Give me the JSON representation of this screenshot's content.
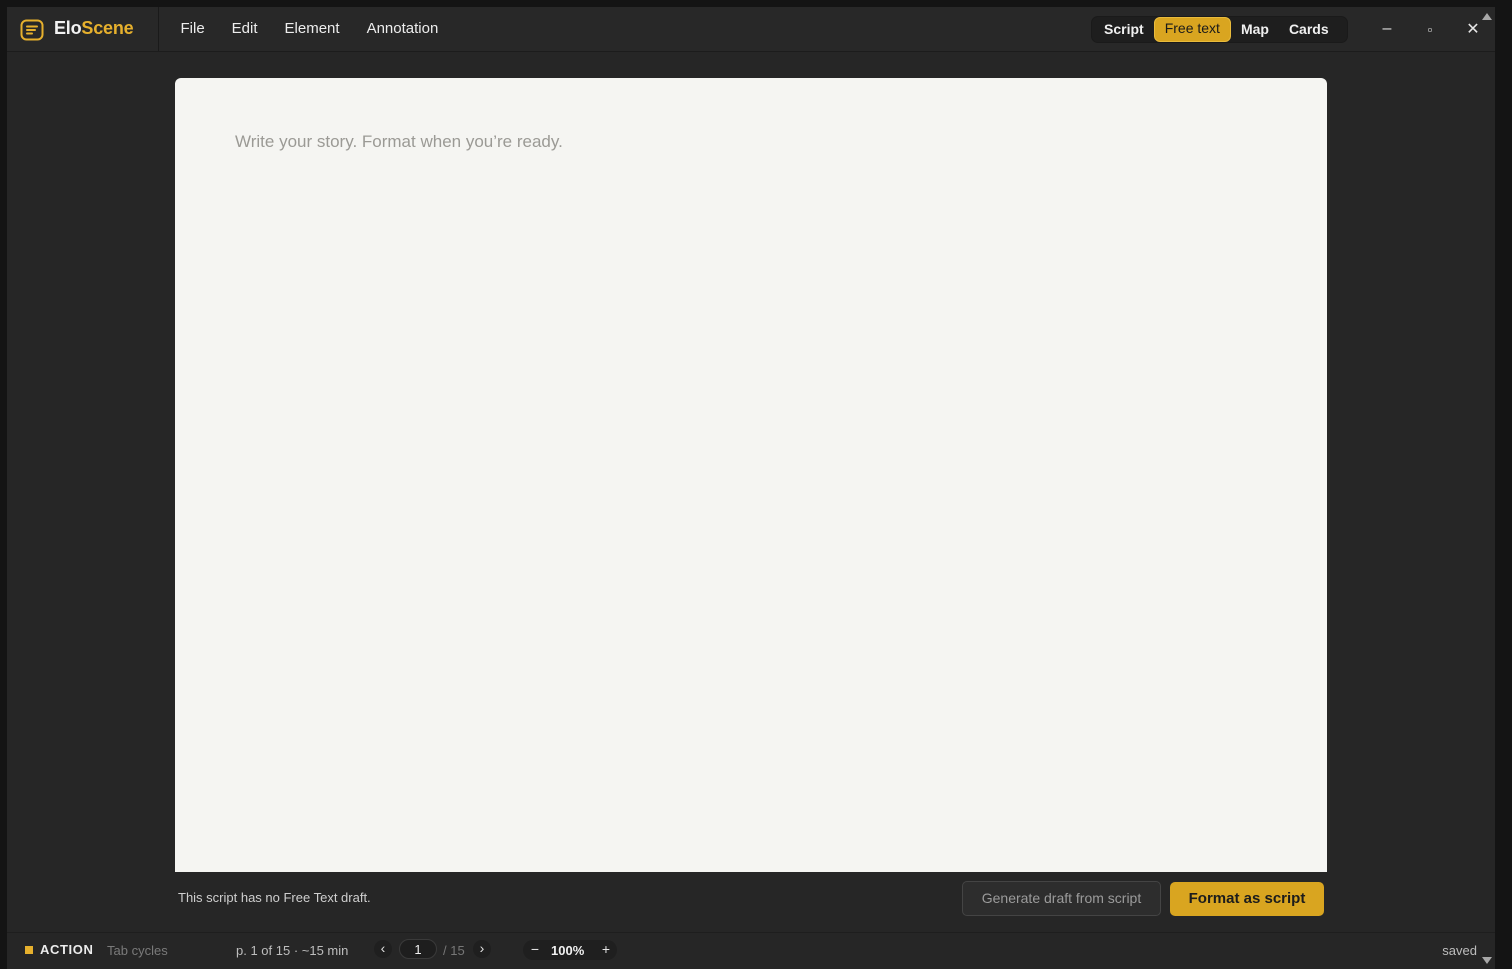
{
  "app": {
    "brand_part1": "Elo",
    "brand_part2": "Scene",
    "accent_color": "#e6b02d",
    "icon": "script-logo-icon"
  },
  "menu": [
    "File",
    "Edit",
    "Element",
    "Annotation"
  ],
  "views": {
    "items": [
      "Script",
      "Free text",
      "Map",
      "Cards"
    ],
    "active": "Free text"
  },
  "window_controls": {
    "minimize": "–",
    "maximize": "▫",
    "close": "✕"
  },
  "editor": {
    "value": "",
    "placeholder": "Write your story. Format when you’re ready."
  },
  "footer": {
    "draft_note": "This script has no Free Text draft.",
    "generate_label": "Generate draft from script",
    "format_label": "Format as script"
  },
  "status": {
    "element_type": "ACTION",
    "hint": "Tab cycles",
    "page_info": "p. 1 of 15 · ~15 min",
    "prev": "‹",
    "next": "›",
    "current_page": "1",
    "total_pages": "/ 15",
    "zoom_out": "−",
    "zoom": "100%",
    "zoom_in": "+",
    "save_state": "saved"
  }
}
